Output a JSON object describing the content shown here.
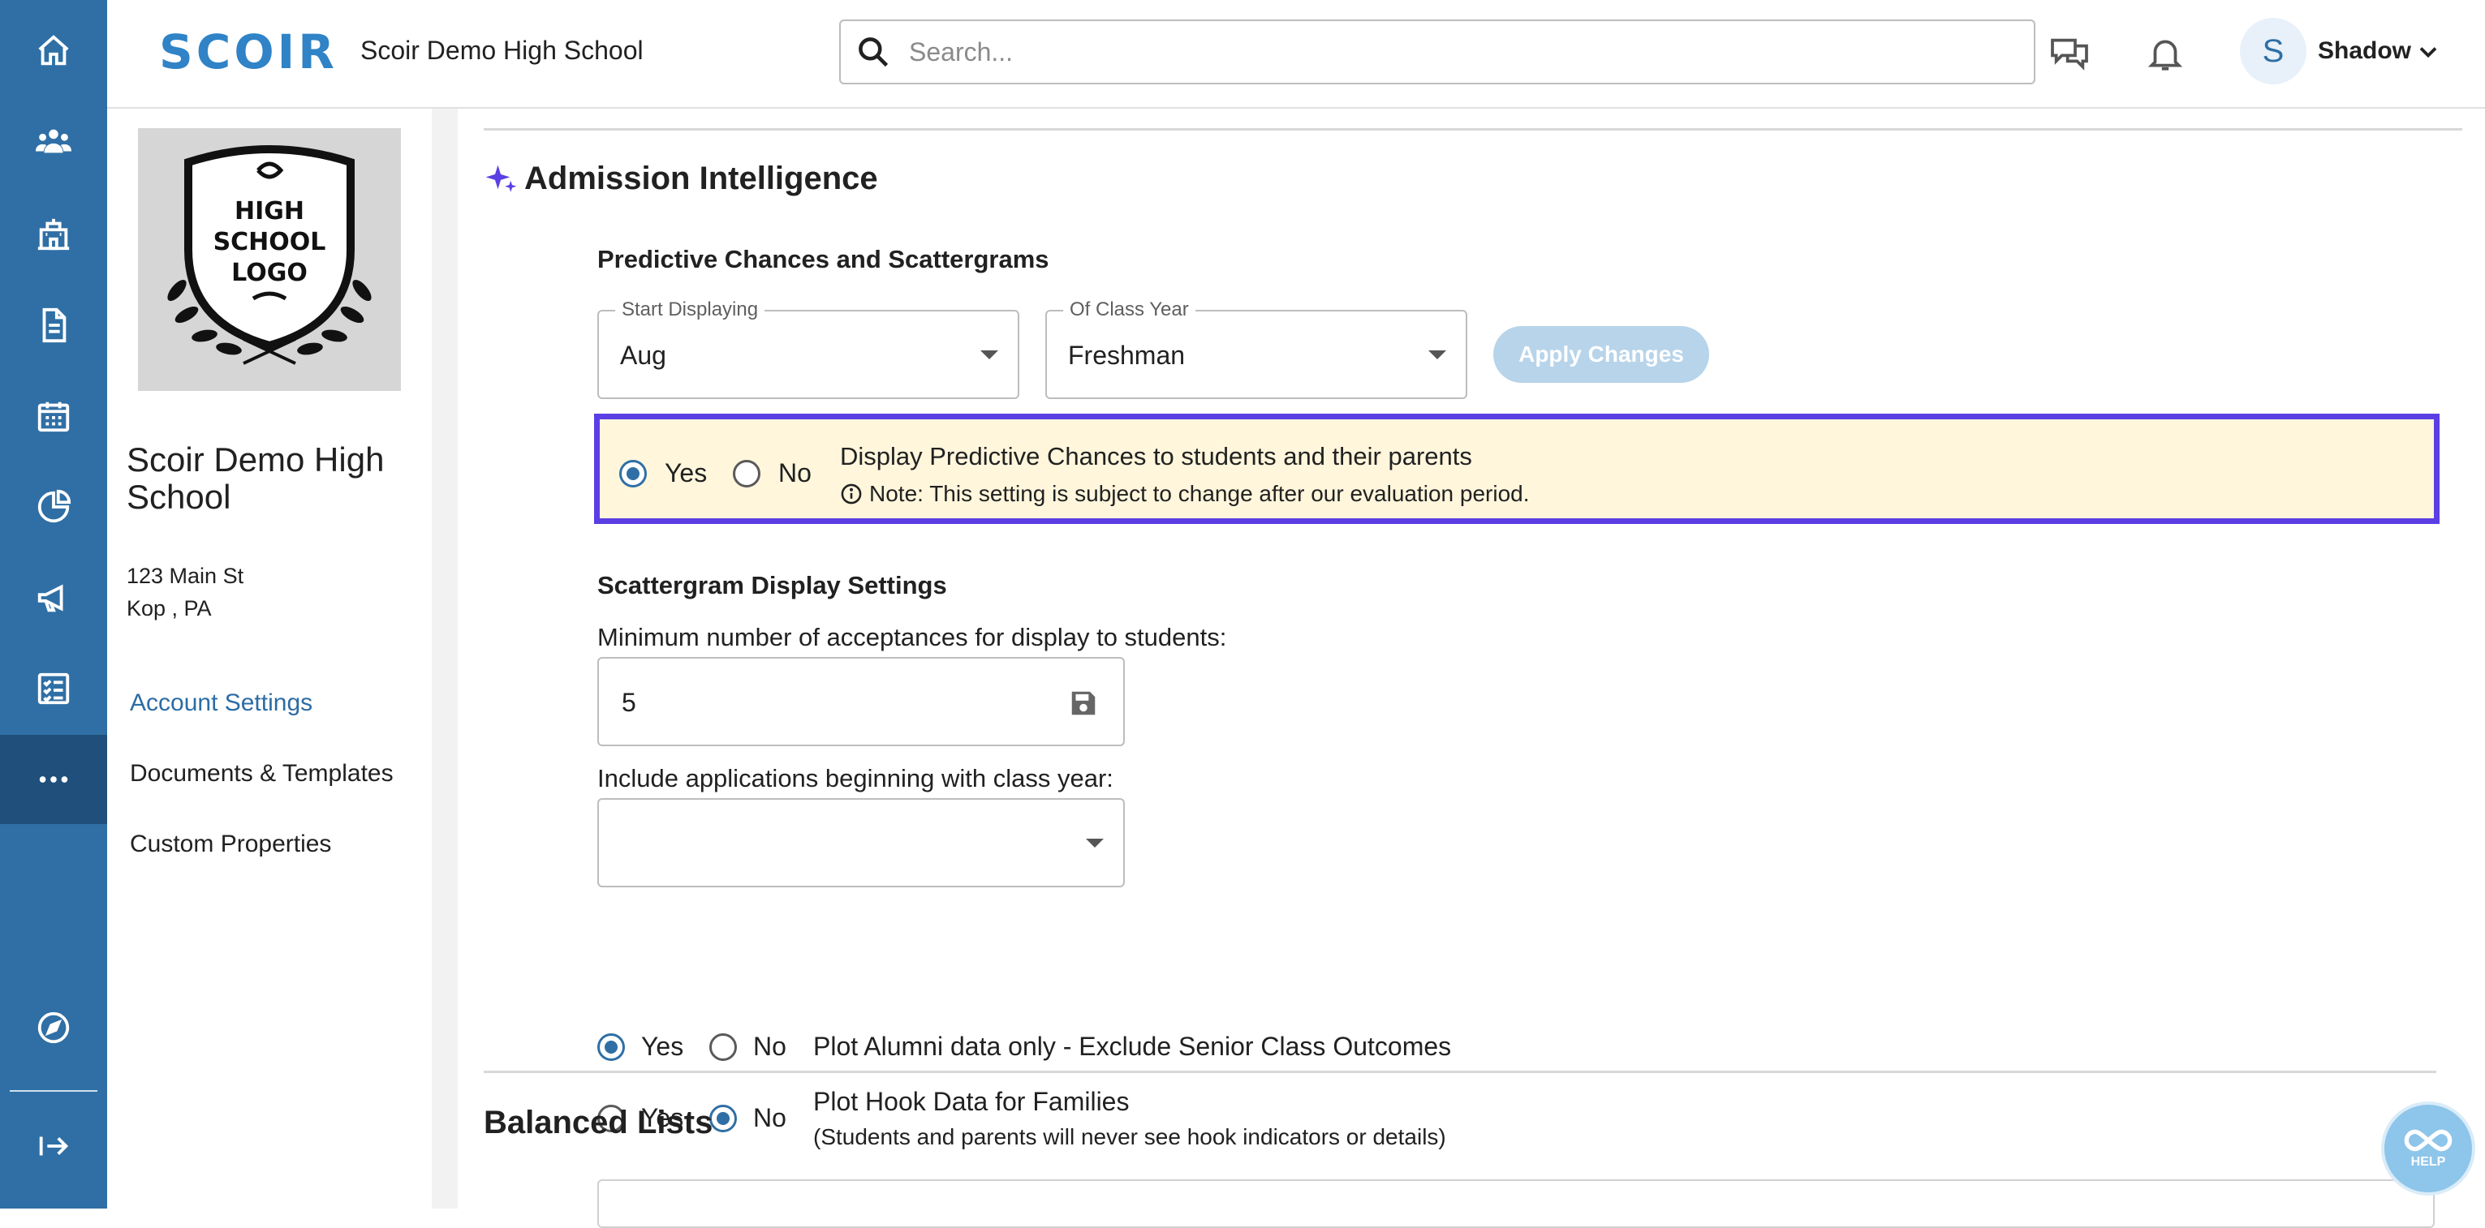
{
  "header": {
    "logo_text": "SCOIR",
    "school_name": "Scoir Demo High School",
    "search_placeholder": "Search...",
    "avatar_initial": "S",
    "user_name": "Shadow"
  },
  "rail": {
    "items": [
      {
        "icon": "home-icon"
      },
      {
        "icon": "people-icon"
      },
      {
        "icon": "school-icon"
      },
      {
        "icon": "document-icon"
      },
      {
        "icon": "calendar-icon"
      },
      {
        "icon": "chart-icon"
      },
      {
        "icon": "megaphone-icon"
      },
      {
        "icon": "checklist-icon"
      },
      {
        "icon": "more-icon",
        "active": true
      }
    ],
    "bottom_items": [
      {
        "icon": "compass-icon"
      },
      {
        "icon": "expand-icon"
      }
    ]
  },
  "sidebar": {
    "logo_lines": [
      "HIGH",
      "SCHOOL",
      "LOGO"
    ],
    "school_title": "Scoir Demo High School",
    "address_line1": "123 Main St",
    "address_line2": "Kop , PA",
    "links": [
      {
        "label": "Account Settings",
        "active": true
      },
      {
        "label": "Documents & Templates"
      },
      {
        "label": "Custom Properties"
      }
    ]
  },
  "main": {
    "section_title": "Admission Intelligence",
    "predictive": {
      "title": "Predictive Chances and Scattergrams",
      "start_label": "Start Displaying",
      "start_value": "Aug",
      "class_year_label": "Of Class Year",
      "class_year_value": "Freshman",
      "apply_button": "Apply Changes",
      "yes_label": "Yes",
      "no_label": "No",
      "display_text": "Display Predictive Chances to students and their parents",
      "note_text": "Note: This setting is subject to change after our evaluation period.",
      "selected": "Yes"
    },
    "scattergram": {
      "title": "Scattergram Display Settings",
      "min_label": "Minimum number of acceptances for display to students:",
      "min_value": "5",
      "include_label": "Include applications beginning with class year:",
      "include_value": "",
      "alumni": {
        "yes": "Yes",
        "no": "No",
        "text": "Plot Alumni data only - Exclude Senior Class Outcomes",
        "selected": "Yes"
      },
      "hook": {
        "yes": "Yes",
        "no": "No",
        "text": "Plot Hook Data for Families",
        "subtext": "(Students and parents will never see hook indicators or details)",
        "selected": "No"
      }
    },
    "balanced_title": "Balanced Lists"
  },
  "help": {
    "label": "HELP"
  },
  "colors": {
    "rail": "#2f6fa5",
    "rail_active": "#1f4f7a",
    "accent": "#2c6ca4",
    "highlight_border": "#5b3fe4",
    "highlight_bg": "#fff6dc",
    "apply_disabled": "#b7d4ea"
  }
}
